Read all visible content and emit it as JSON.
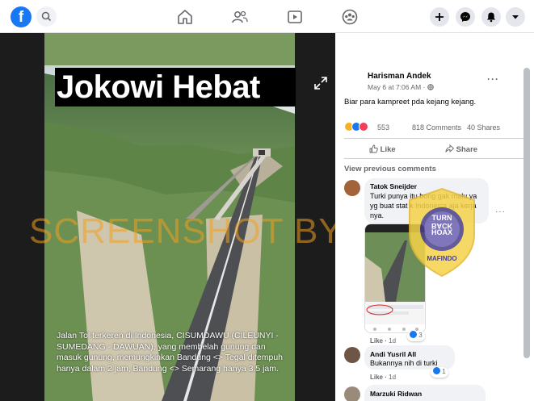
{
  "topbar": {
    "logo_letter": "f",
    "icons": [
      "search-icon",
      "home-icon",
      "friends-icon",
      "watch-icon",
      "groups-icon",
      "plus-icon",
      "messenger-icon",
      "notifications-icon",
      "account-menu-icon"
    ]
  },
  "media": {
    "image_title": "Jokowi Hebat",
    "caption": "Jalan Tol terkeren di Indonesia, CISUMDAWU (CILEUNYI - SUMEDANG - DAWUAN), yang membelah gunung dan masuk gunung, memungkinkan Bandung <> Tegal ditempuh hanya dalam 2 jam, Bandung <> Semarang hanya 3.5 jam.",
    "watermark": "SCREENSHOT BY"
  },
  "post": {
    "author": "Harisman Andek",
    "timestamp": "May 6 at 7:06 AM ·",
    "text": "Biar para kampreet pda kejang kejang.",
    "reaction_count": "553",
    "comments_count": "818 Comments",
    "shares_count": "40 Shares",
    "like_label": "Like",
    "share_label": "Share",
    "more": "···"
  },
  "comments": {
    "view_previous": "View previous comments",
    "items": [
      {
        "name": "Tatok Sneijder",
        "text": "Turki punya itu bong gak malu ya yg buat stat k Indonesia aja kerja nya.",
        "like": "Like",
        "time": "1d",
        "reacts": "3"
      },
      {
        "name": "Andi Yusril All",
        "text": "Bukannya nih di turki",
        "like": "Like",
        "time": "1d",
        "reacts": "1"
      },
      {
        "name": "Marzuki Ridwan",
        "text": "",
        "like": "",
        "time": "",
        "reacts": ""
      }
    ]
  },
  "badge": {
    "line1": "TURN",
    "line2": "BACK",
    "line3": "HOAX",
    "brand": "MAFINDO",
    "ring_text": "MASYARAKAT ANTIFITNAH INDONESIA"
  },
  "colors": {
    "brand": "#1877f2",
    "badge_yellow": "#f5d34a",
    "badge_purple": "#4a3f8a",
    "watermark": "#f0a01e"
  }
}
